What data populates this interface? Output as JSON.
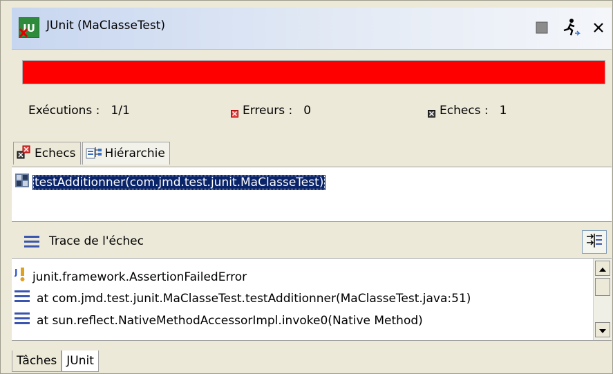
{
  "window": {
    "title": "JUnit (MaClasseTest)",
    "icon": "junit-icon",
    "controls": [
      "minimize-icon",
      "runner-icon",
      "close-icon"
    ]
  },
  "progress": {
    "status": "failed",
    "color": "#ff0000",
    "fraction": 1.0
  },
  "counters": {
    "executions_label": "Exécutions :",
    "executions_value": "1/1",
    "errors_label": "Erreurs :",
    "errors_value": "0",
    "failures_label": "Echecs :",
    "failures_value": "1"
  },
  "tabs": [
    {
      "label": "Echecs",
      "icon": "failures-icon",
      "active": true
    },
    {
      "label": "Hiérarchie",
      "icon": "hierarchy-icon",
      "active": false
    }
  ],
  "failures": [
    {
      "label": "testAdditionner(com.jmd.test.junit.MaClasseTest)",
      "selected": true
    }
  ],
  "trace": {
    "title": "Trace de l'échec",
    "lines": [
      {
        "icon": "junit-exception-icon",
        "text": "junit.framework.AssertionFailedError"
      },
      {
        "icon": "stack-frame-icon",
        "text": "at com.jmd.test.junit.MaClasseTest.testAdditionner(MaClasseTest.java:51)"
      },
      {
        "icon": "stack-frame-icon",
        "text": "at sun.reflect.NativeMethodAccessorImpl.invoke0(Native Method)"
      }
    ]
  },
  "bottom_tabs": [
    {
      "label": "Tâches",
      "active": false
    },
    {
      "label": "JUnit",
      "active": true
    }
  ],
  "colors": {
    "selection": "#0a246a",
    "error_red": "#ff0000",
    "title_gradient_start": "#c7d6f0"
  }
}
